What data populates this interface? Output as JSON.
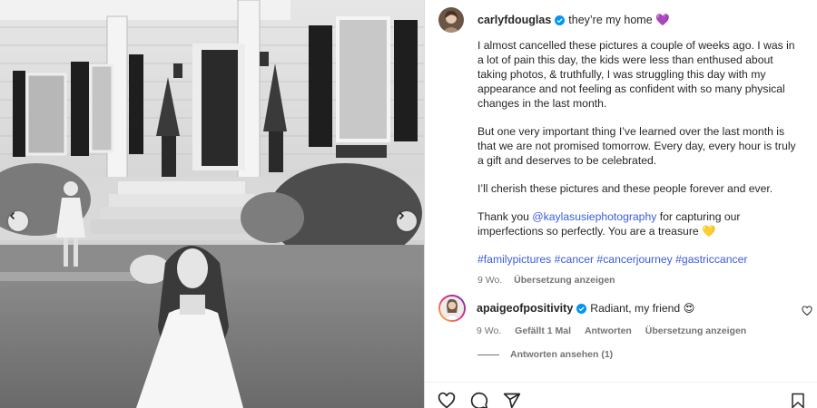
{
  "post": {
    "username": "carlyfdouglas",
    "title": "they’re my home 💜",
    "paragraphs": [
      "I almost cancelled these pictures a couple of weeks ago. I was in a lot of pain this day, the kids were less than enthused about taking photos, & truthfully, I was struggling this day with my appearance and not feeling as confident with so many physical changes in the last month.",
      "But one very important thing I’ve learned over the last month is that we are not promised tomorrow. Every day, every hour is truly a gift and deserves to be celebrated.",
      "I’ll cherish these pictures and these people forever and ever."
    ],
    "thanks_prefix": "Thank you ",
    "thanks_mention": "@kaylasusiephotography",
    "thanks_suffix": " for capturing our imperfections so perfectly. You are a treasure 💛",
    "hashtags": [
      "#familypictures",
      "#cancer",
      "#cancerjourney",
      "#gastriccancer"
    ],
    "age": "9 Wo.",
    "translate_label": "Übersetzung anzeigen"
  },
  "comment": {
    "username": "apaigeofpositivity",
    "text": "Radiant, my friend 😍",
    "age": "9 Wo.",
    "likes_label": "Gefällt 1 Mal",
    "reply_label": "Antworten",
    "translate_label": "Übersetzung anzeigen",
    "view_replies_label": "Antworten ansehen (1)"
  },
  "colors": {
    "link": "#3b5bdb",
    "verified": "#0095f6",
    "muted": "#737373"
  },
  "icons": {
    "actions": [
      "heart-icon",
      "comment-icon",
      "share-icon"
    ],
    "save": "bookmark-icon",
    "carousel": [
      "chevron-left-icon",
      "chevron-right-icon"
    ]
  }
}
